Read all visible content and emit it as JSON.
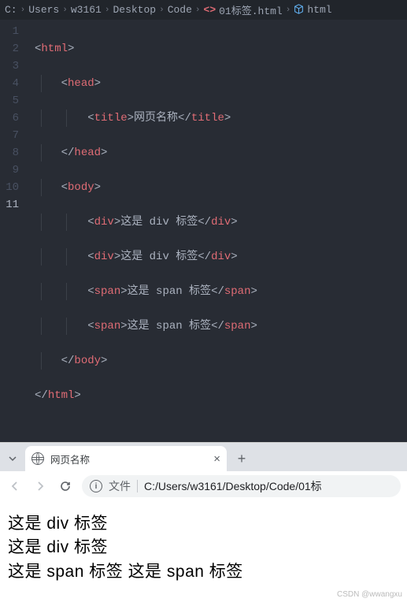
{
  "breadcrumbs": {
    "parts": [
      "C:",
      "Users",
      "w3161",
      "Desktop",
      "Code"
    ],
    "file": "01标签.html",
    "symbol": "html"
  },
  "code": {
    "line_numbers": [
      "1",
      "2",
      "3",
      "4",
      "5",
      "6",
      "7",
      "8",
      "9",
      "10",
      "11"
    ],
    "current_line": 11,
    "l1_tag": "html",
    "l2_tag": "head",
    "l3_tag": "title",
    "l3_text": "网页名称",
    "l4_tag": "head",
    "l5_tag": "body",
    "l6_tag": "div",
    "l6_text": "这是 div 标签",
    "l7_tag": "div",
    "l7_text": "这是 div 标签",
    "l8_tag": "span",
    "l8_text": "这是 span 标签",
    "l9_tag": "span",
    "l9_text": "这是 span 标签",
    "l10_tag": "body",
    "l11_tag": "html"
  },
  "browser": {
    "tab_title": "网页名称",
    "file_label": "文件",
    "url": "C:/Users/w3161/Desktop/Code/01标",
    "page": {
      "div1": "这是 div 标签",
      "div2": "这是 div 标签",
      "span1": "这是 span 标签",
      "span2": "这是 span 标签"
    }
  },
  "watermark": "CSDN @wwangxu"
}
